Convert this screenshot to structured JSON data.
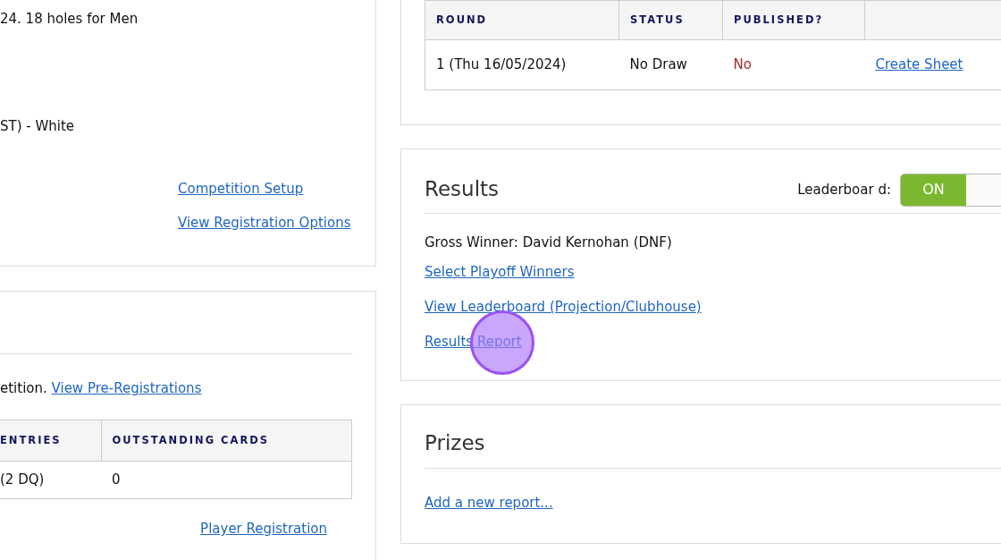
{
  "details_panel": {
    "lines": [
      "24. 18 holes for Men",
      "ST) - White"
    ],
    "links": [
      "Competition Setup",
      "View Registration Options"
    ]
  },
  "entries_panel": {
    "text": "etition.",
    "link": "View Pre-Registrations",
    "table": {
      "columns": [
        "ENTRIES",
        "OUTSTANDING CARDS"
      ],
      "rows": [
        [
          "(2 DQ)",
          "0"
        ]
      ]
    },
    "bottom_link": "Player Registration"
  },
  "rounds_table": {
    "columns": [
      "ROUND",
      "STATUS",
      "PUBLISHED?"
    ],
    "rows": [
      {
        "round": "1 (Thu 16/05/2024)",
        "status": "No Draw",
        "published": "No",
        "published_flag": false,
        "action": "Create Sheet"
      }
    ]
  },
  "results": {
    "title": "Results",
    "toggle_label": "Leaderboar d:",
    "toggle": {
      "label": "ON",
      "on": true
    },
    "summary": "Gross Winner: David Kernohan (DNF)",
    "links": [
      "Select Playoff Winners",
      "View Leaderboard (Projection/Clubhouse)",
      "Results Report"
    ]
  },
  "prizes": {
    "title": "Prizes",
    "link": "Add a new report..."
  },
  "click_highlight": true
}
